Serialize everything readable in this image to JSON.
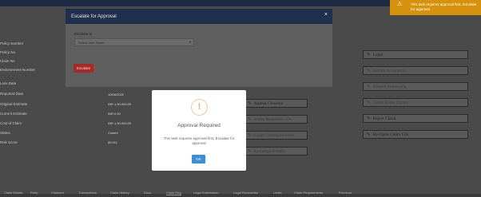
{
  "toast": {
    "message": "This task requires approval first, Escalate for approval"
  },
  "escalate_modal": {
    "title": "Escalate for Approval",
    "close": "×",
    "field_label": "Escalate to",
    "required_mark": "*",
    "select_placeholder": "Select User Name",
    "button": "Escalate"
  },
  "approval_modal": {
    "title": "Approval Required",
    "message": "This task requires approval first, Escalate for approval",
    "ok": "OK"
  },
  "labels": [
    "Policy Number",
    "Policy No",
    "Claim No",
    "Endorsement Number",
    "Loss Date",
    "Reported Date",
    "Original Estimate",
    "Current Estimate",
    "Cost of Claim",
    "Status",
    "Risk Score"
  ],
  "values": [
    "10/08/2022",
    "INR 1,00,000.00",
    "INR 0.00",
    "INR 1,00,000.00",
    "Closed",
    "89.911"
  ],
  "actions": {
    "legal": "Legal",
    "initiate_arbitration": "Initiate Arbitration",
    "reopen_processing": "Reopen Processing",
    "claim_rules": "Claim Rules Update",
    "appeal": "Appeal Closeout",
    "reject_claim": "Reject Claim",
    "claim_response": "Claim Response - Ok",
    "claim_correspondence": "Claim Correspondence",
    "reopen_claim": "Re-Open Claim File",
    "exchange": "Exchange Details"
  },
  "tabs": [
    "Claim Details",
    "Party",
    "Claimant",
    "Transactions",
    "Claim History",
    "Docs",
    "Claim Reg",
    "Legal Submission",
    "Legal Recoveries",
    "Limits",
    "Claim Requirements",
    "Premium"
  ]
}
